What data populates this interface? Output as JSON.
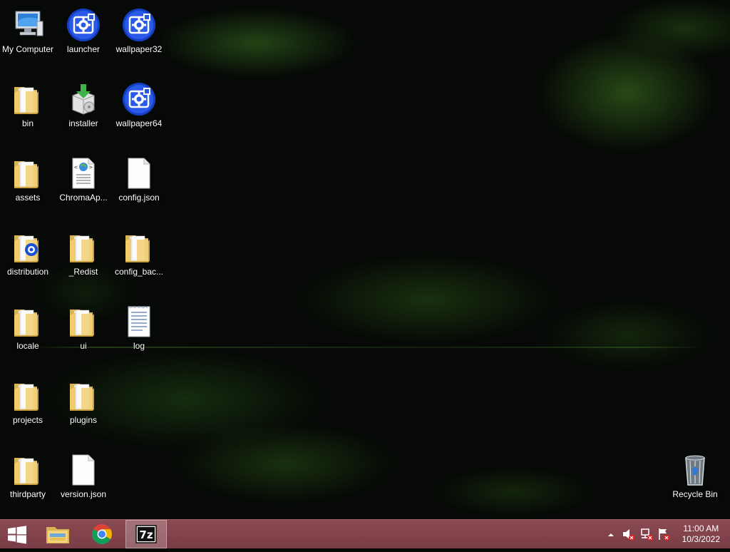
{
  "desktop": {
    "icons": {
      "my_computer": "My Computer",
      "launcher": "launcher",
      "wallpaper32": "wallpaper32",
      "bin": "bin",
      "installer": "installer",
      "wallpaper64": "wallpaper64",
      "assets": "assets",
      "chroma_app": "ChromaAp...",
      "config_json": "config.json",
      "distribution": "distribution",
      "redist": "_Redist",
      "config_backup": "config_bac...",
      "locale": "locale",
      "ui": "ui",
      "log": "log",
      "projects": "projects",
      "plugins": "plugins",
      "thirdparty": "thirdparty",
      "version_json": "version.json",
      "recycle_bin": "Recycle Bin"
    }
  },
  "taskbar": {
    "pinned": [
      "start-icon",
      "file-explorer-icon",
      "chrome-icon",
      "7zip-icon"
    ],
    "clock": {
      "time": "11:00 AM",
      "date": "10/3/2022"
    },
    "tray_icons": [
      "show-hidden-icons-chevron",
      "volume-muted-icon",
      "network-error-icon",
      "action-center-flag-icon"
    ]
  },
  "colors": {
    "taskbar": "#7f424b",
    "app_icon_blue": "#1a4fd6",
    "folder_yellow": "#f2d27a"
  }
}
